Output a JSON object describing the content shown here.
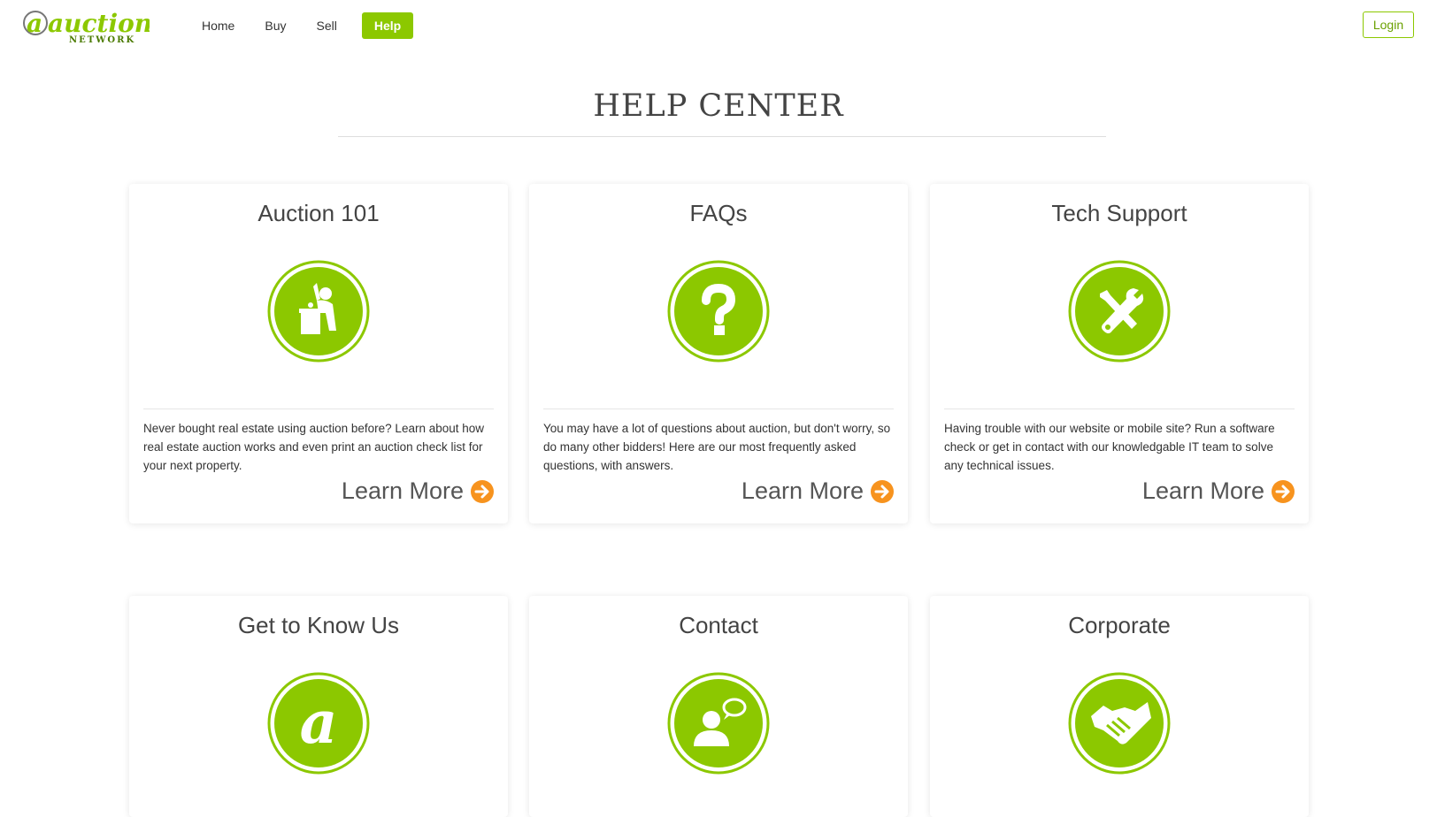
{
  "header": {
    "logo_text": "auction",
    "logo_subtext": "NETWORK",
    "nav": [
      {
        "label": "Home"
      },
      {
        "label": "Buy"
      },
      {
        "label": "Sell"
      },
      {
        "label": "Help"
      }
    ],
    "login_label": "Login"
  },
  "page_title": "HELP CENTER",
  "cards": [
    {
      "title": "Auction 101",
      "icon": "auctioneer-podium-icon",
      "description": "Never bought real estate using auction before? Learn about how real estate auction works and even print an auction check list for your next property.",
      "link": "Learn More"
    },
    {
      "title": "FAQs",
      "icon": "question-mark-icon",
      "description": "You may have a lot of questions about auction, but don't worry, so do many other bidders! Here are our most frequently asked questions, with answers.",
      "link": "Learn More"
    },
    {
      "title": "Tech Support",
      "icon": "wrench-screwdriver-icon",
      "description": "Having trouble with our website or mobile site? Run a software check or get in contact with our knowledgable IT team to solve any technical issues.",
      "link": "Learn More"
    },
    {
      "title": "Get to Know Us",
      "icon": "at-letter-icon"
    },
    {
      "title": "Contact",
      "icon": "person-speech-bubble-icon"
    },
    {
      "title": "Corporate",
      "icon": "handshake-icon"
    }
  ],
  "colors": {
    "accent_green": "#8cc800",
    "arrow_orange": "#f7931e"
  }
}
